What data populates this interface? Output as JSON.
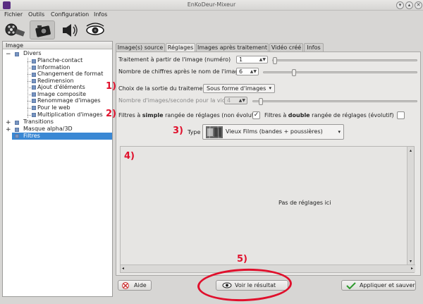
{
  "window": {
    "title": "EnKoDeur-Mixeur"
  },
  "menu": {
    "fichier": "Fichier",
    "outils": "Outils",
    "configuration": "Configuration",
    "infos": "Infos"
  },
  "tree": {
    "header": "Image",
    "divers": "Divers",
    "items": [
      "Planche-contact",
      "Information",
      "Changement de format",
      "Redimension",
      "Ajout d'éléments",
      "Image composite",
      "Renommage d'images",
      "Pour le web",
      "Multiplication d'images"
    ],
    "transitions": "Transitions",
    "masque": "Masque alpha/3D",
    "filtres": "Filtres"
  },
  "tabs": [
    "Image(s) source",
    "Réglages",
    "Images après traitement",
    "Vidéo créé",
    "Infos"
  ],
  "settings": {
    "traitement_label": "Traitement à partir de l'image (numéro)",
    "traitement_value": "1",
    "chiffres_label": "Nombre de chiffres après le nom de l'image",
    "chiffres_value": "6",
    "sortie_label": "Choix de la sortie du traitement",
    "sortie_value": "Sous forme d'images",
    "fps_label": "Nombre d'images/seconde pour la vidéo",
    "fps_value": "4",
    "simple_prefix": "Filtres à ",
    "simple_bold": "simple",
    "simple_suffix": " rangée de réglages (non évolutif)",
    "double_prefix": "Filtres à ",
    "double_bold": "double",
    "double_suffix": " rangée de réglages (évolutif)",
    "type_label": "Type",
    "type_value": "Vieux Films (bandes + poussières)",
    "no_settings": "Pas de réglages ici"
  },
  "annotations": {
    "a1": "1)",
    "a2": "2)",
    "a3": "3)",
    "a4": "4)",
    "a5": "5)"
  },
  "buttons": {
    "aide": "Aide",
    "voir": "Voir le résultat",
    "appliquer": "Appliquer et sauver"
  },
  "colors": {
    "annotation": "#e0102c",
    "selection": "#3a88d4"
  }
}
